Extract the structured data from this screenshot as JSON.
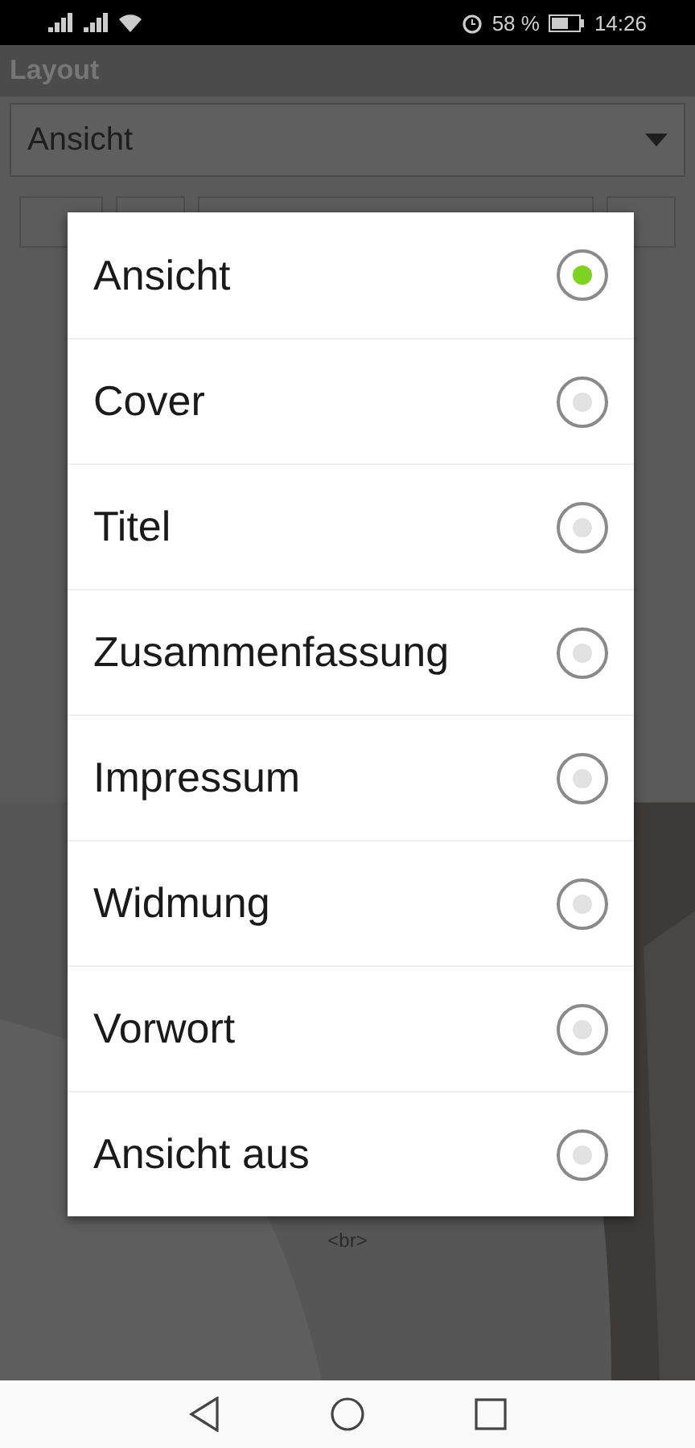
{
  "status_bar": {
    "battery": "58 %",
    "time": "14:26"
  },
  "screen": {
    "title": "Layout",
    "spinner": {
      "value": "Ansicht"
    },
    "footer_text": "<br>"
  },
  "dialog": {
    "options": [
      {
        "label": "Ansicht",
        "selected": true
      },
      {
        "label": "Cover",
        "selected": false
      },
      {
        "label": "Titel",
        "selected": false
      },
      {
        "label": "Zusammenfassung",
        "selected": false
      },
      {
        "label": "Impressum",
        "selected": false
      },
      {
        "label": "Widmung",
        "selected": false
      },
      {
        "label": "Vorwort",
        "selected": false
      },
      {
        "label": "Ansicht aus",
        "selected": false
      }
    ]
  }
}
